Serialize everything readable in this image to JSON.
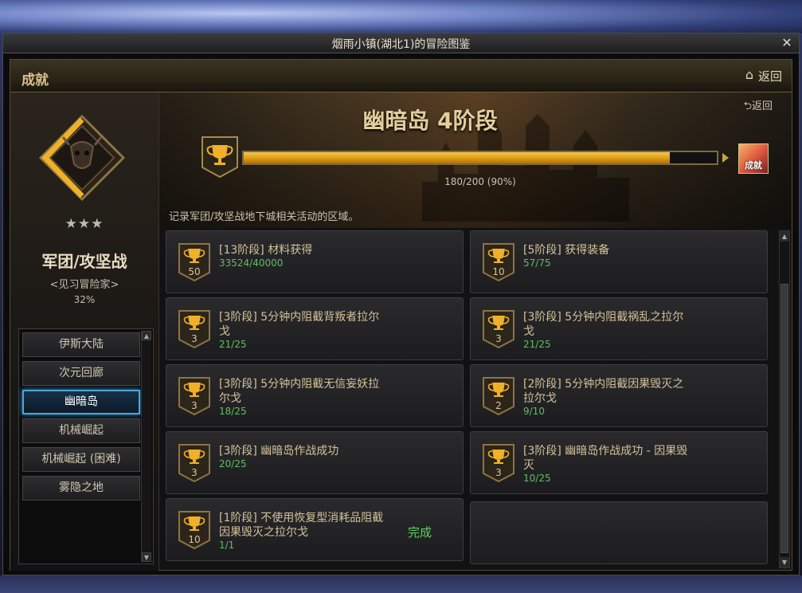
{
  "window": {
    "title": "烟雨小镇(湖北1)的冒险图鉴",
    "close": "✕"
  },
  "header": {
    "label": "成就",
    "home_icon": "⌂",
    "back": "返回"
  },
  "category": {
    "stars": "★★★",
    "name": "军团/攻坚战",
    "subtitle": "<见习冒险家>",
    "percent": "32%"
  },
  "nav": {
    "items": [
      {
        "label": "伊斯大陆"
      },
      {
        "label": "次元回廊"
      },
      {
        "label": "幽暗岛"
      },
      {
        "label": "机械崛起"
      },
      {
        "label": "机械崛起 (困难)"
      },
      {
        "label": "雾隐之地"
      }
    ],
    "active_index": 2
  },
  "banner": {
    "back": "⮌返回",
    "title": "幽暗岛 4阶段",
    "progress_text": "180/200 (90%)",
    "progress_fraction": 0.9,
    "reward_label": "成就",
    "description": "记录军团/攻坚战地下城相关活动的区域。"
  },
  "achievements": [
    {
      "title": "[13阶段] 材料获得",
      "progress": "33524/40000",
      "badge": "50",
      "done": ""
    },
    {
      "title": "[5阶段] 获得装备",
      "progress": "57/75",
      "badge": "10",
      "done": ""
    },
    {
      "title": "[3阶段] 5分钟内阻截背叛者拉尔戈",
      "progress": "21/25",
      "badge": "3",
      "done": ""
    },
    {
      "title": "[3阶段] 5分钟内阻截祸乱之拉尔戈",
      "progress": "21/25",
      "badge": "3",
      "done": ""
    },
    {
      "title": "[3阶段] 5分钟内阻截无信妄妖拉尔戈",
      "progress": "18/25",
      "badge": "3",
      "done": ""
    },
    {
      "title": "[2阶段] 5分钟内阻截因果毁灭之拉尔戈",
      "progress": "9/10",
      "badge": "2",
      "done": ""
    },
    {
      "title": "[3阶段] 幽暗岛作战成功",
      "progress": "20/25",
      "badge": "3",
      "done": ""
    },
    {
      "title": "[3阶段] 幽暗岛作战成功 - 因果毁灭",
      "progress": "10/25",
      "badge": "3",
      "done": ""
    },
    {
      "title": "[1阶段] 不使用恢复型消耗品阻截因果毁灭之拉尔戈",
      "progress": "1/1",
      "badge": "10",
      "done": "完成"
    }
  ],
  "colors": {
    "accent_gold": "#e09f18",
    "progress_green": "#5fbf5f",
    "active_blue": "#4aa7d8"
  }
}
